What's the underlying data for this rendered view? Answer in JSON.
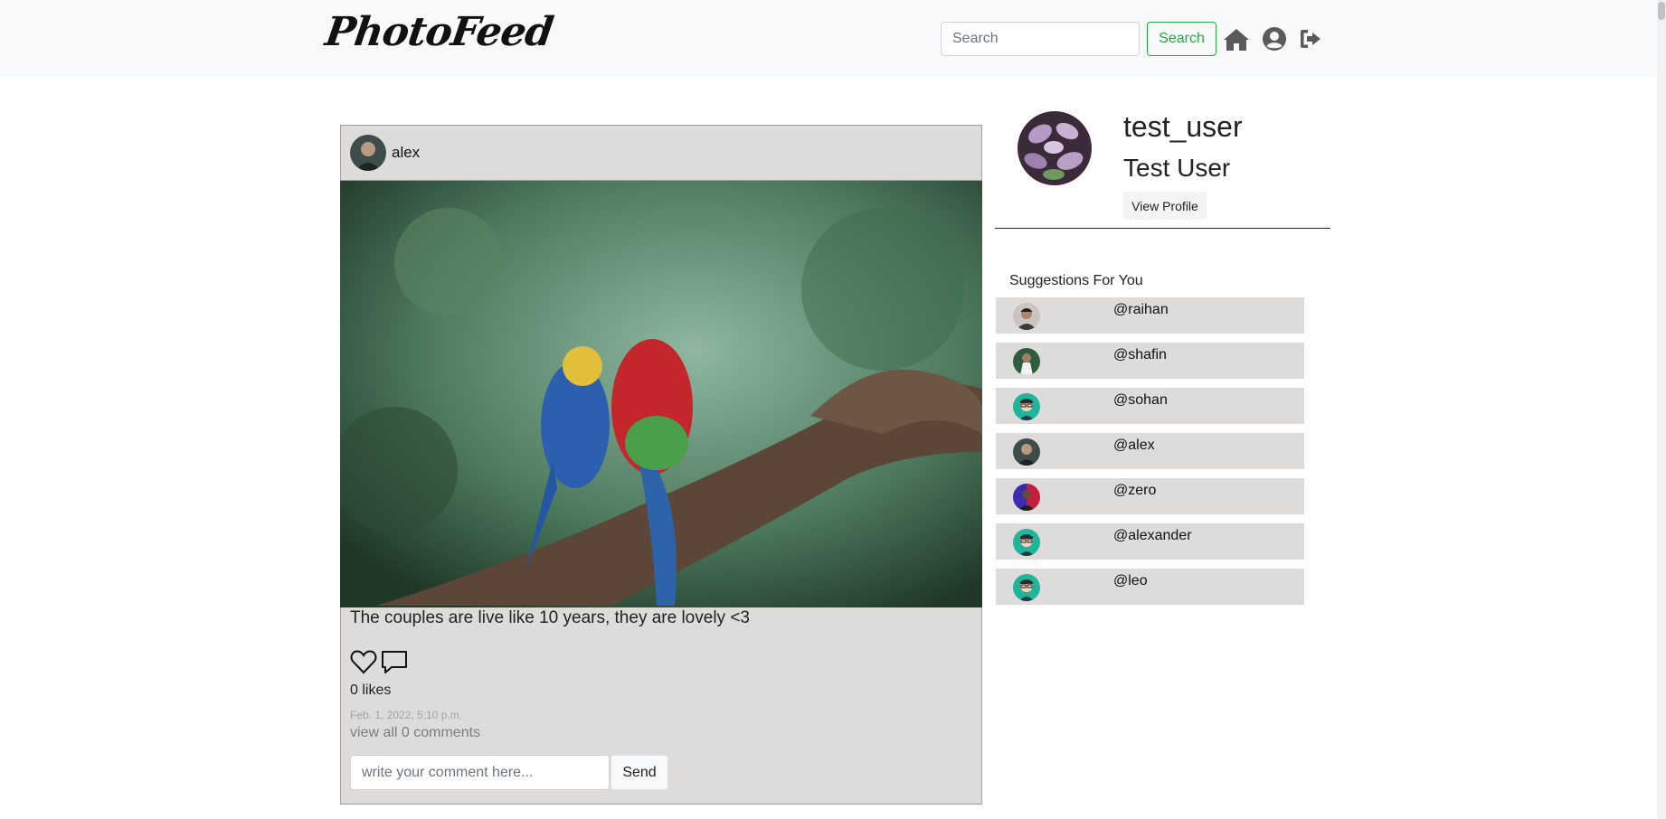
{
  "navbar": {
    "logo": "PhotoFeed",
    "search_placeholder": "Search",
    "search_button": "Search",
    "icons": [
      "home-icon",
      "user-circle-icon",
      "sign-out-icon"
    ]
  },
  "post": {
    "author": "alex",
    "caption": "The couples are live like 10 years, they are lovely <3",
    "likes": "0 likes",
    "date": "Feb. 1, 2022, 5:10 p.m.",
    "view_comments": "view all 0 comments",
    "comment_placeholder": "write your comment here...",
    "send_label": "Send"
  },
  "profile": {
    "username": "test_user",
    "full_name": "Test User",
    "view_profile": "View Profile"
  },
  "suggestions": {
    "title": "Suggestions For You",
    "items": [
      {
        "handle": "@raihan",
        "avatar": "raihan"
      },
      {
        "handle": "@shafin",
        "avatar": "shafin"
      },
      {
        "handle": "@sohan",
        "avatar": "cartoon"
      },
      {
        "handle": "@alex",
        "avatar": "alex"
      },
      {
        "handle": "@zero",
        "avatar": "zero"
      },
      {
        "handle": "@alexander",
        "avatar": "cartoon"
      },
      {
        "handle": "@leo",
        "avatar": "cartoon"
      }
    ]
  },
  "colors": {
    "nav_bg": "#f8f9fa",
    "accent_green": "#28a745",
    "card_bg": "#dedbdb"
  }
}
